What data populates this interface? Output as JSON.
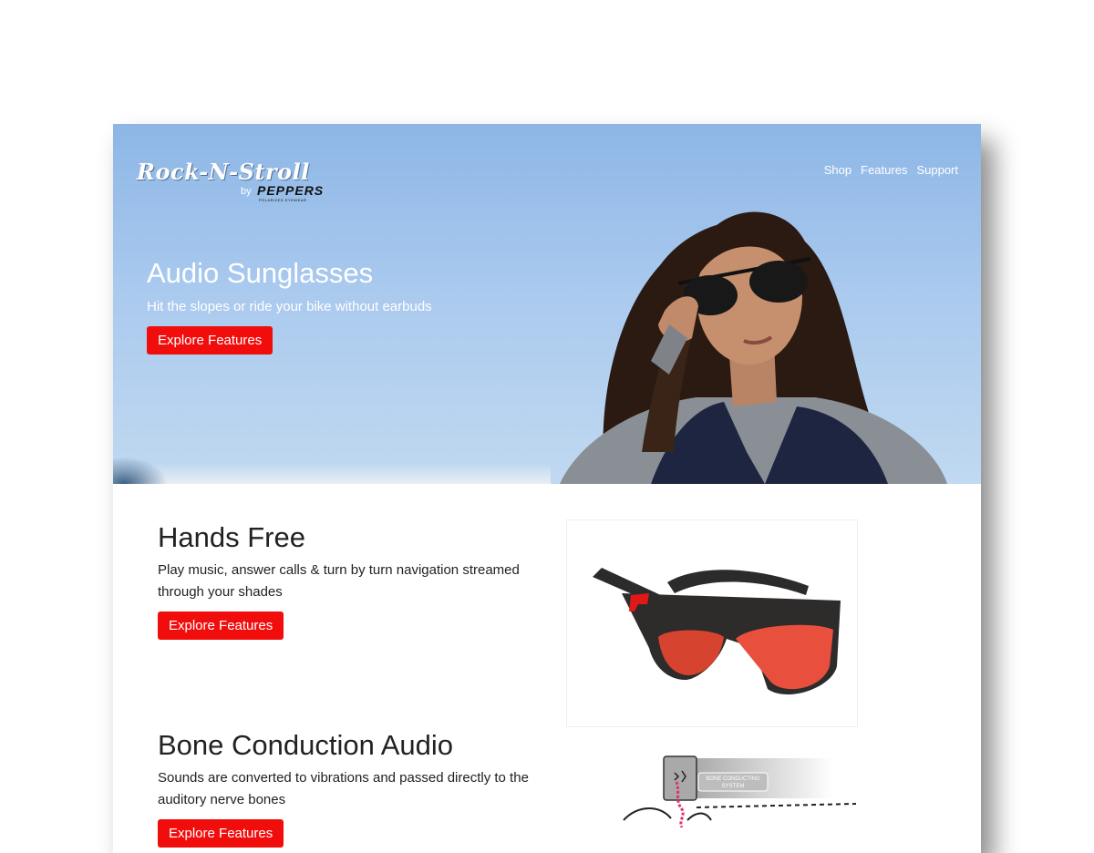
{
  "brand": {
    "name": "Rock-N-Stroll",
    "by": "by",
    "maker": "PEPPERS",
    "maker_tagline": "POLARIZED EYEWEAR"
  },
  "nav": {
    "items": [
      {
        "label": "Shop"
      },
      {
        "label": "Features"
      },
      {
        "label": "Support"
      }
    ]
  },
  "hero": {
    "title": "Audio Sunglasses",
    "subtitle": "Hit the slopes or ride your bike without earbuds",
    "cta_label": "Explore Features"
  },
  "features": [
    {
      "title": "Hands Free",
      "description": "Play music, answer calls & turn by turn navigation streamed through your shades",
      "cta_label": "Explore Features"
    },
    {
      "title": "Bone Conduction Audio",
      "description": "Sounds are converted to vibrations and passed directly to the auditory nerve bones",
      "cta_label": "Explore Features"
    }
  ],
  "diagram": {
    "label_line1": "BONE CONDUCTING",
    "label_line2": "SYSTEM"
  },
  "colors": {
    "accent": "#f20d0d",
    "sky": "#a9c9ee",
    "text": "#222222"
  }
}
